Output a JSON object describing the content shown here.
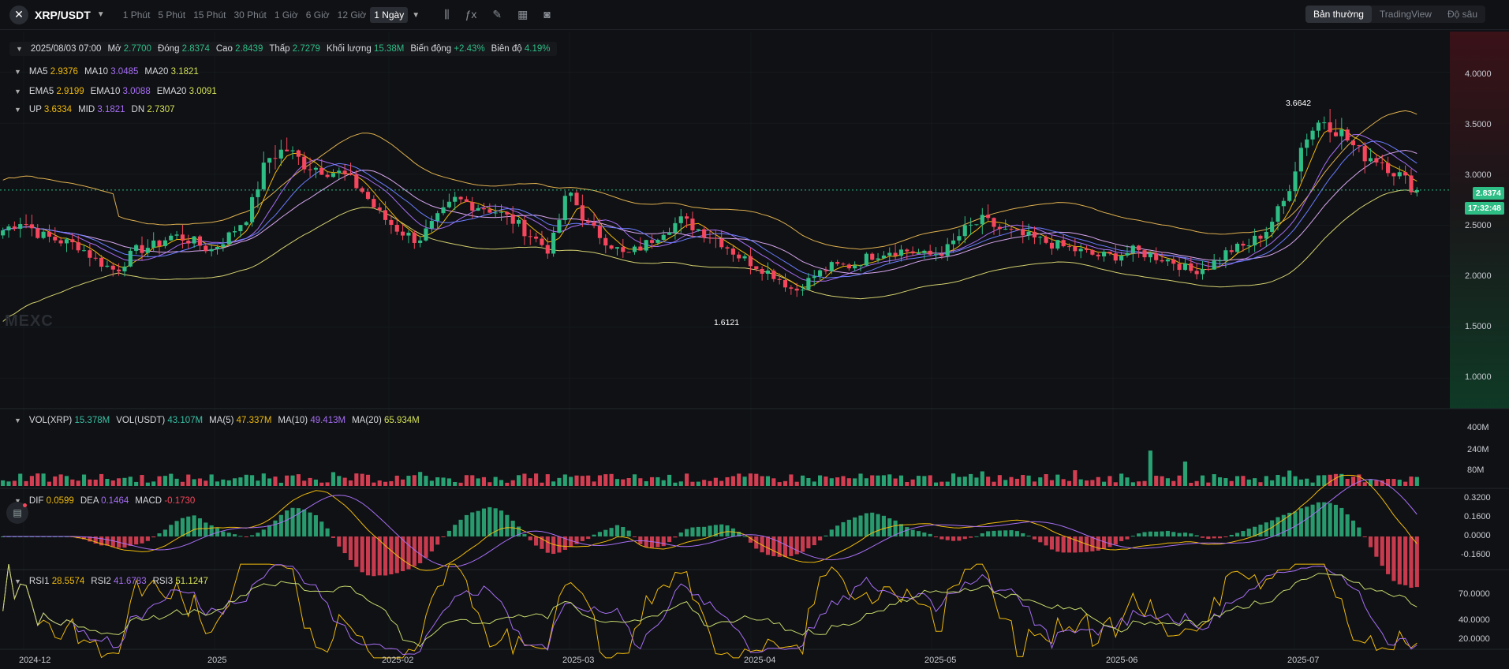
{
  "header": {
    "symbol": "XRP/USDT",
    "intervals": [
      "1 Phút",
      "5 Phút",
      "15 Phút",
      "30 Phút",
      "1 Giờ",
      "6 Giờ",
      "12 Giờ",
      "1 Ngày"
    ],
    "active_interval": "1 Ngày",
    "views": [
      "Bản thường",
      "TradingView",
      "Độ sâu"
    ],
    "active_view": "Bản thường"
  },
  "ohlc": {
    "date": "2025/08/03 07:00",
    "open_label": "Mở",
    "open": "2.7700",
    "close_label": "Đóng",
    "close": "2.8374",
    "high_label": "Cao",
    "high": "2.8439",
    "low_label": "Thấp",
    "low": "2.7279",
    "vol_label": "Khối lượng",
    "vol": "15.38M",
    "change_label": "Biến động",
    "change": "+2.43%",
    "amp_label": "Biên độ",
    "amp": "4.19%"
  },
  "ma": {
    "ma5": "2.9376",
    "ma10": "3.0485",
    "ma20": "3.1821"
  },
  "ema": {
    "ema5": "2.9199",
    "ema10": "3.0088",
    "ema20": "3.0091"
  },
  "boll": {
    "up": "3.6334",
    "mid": "3.1821",
    "dn": "2.7307"
  },
  "vol": {
    "xrp": "15.378M",
    "usdt": "43.107M",
    "ma5": "47.337M",
    "ma10": "49.413M",
    "ma20": "65.934M"
  },
  "macd": {
    "dif": "0.0599",
    "dea": "0.1464",
    "macd": "-0.1730"
  },
  "rsi": {
    "rsi1": "28.5574",
    "rsi2": "41.6783",
    "rsi3": "51.1247"
  },
  "watermark": "MEXC",
  "current_price": "2.8374",
  "countdown": "17:32:48",
  "high_mark": "3.6642",
  "low_mark": "1.6121",
  "colors": {
    "up": "#2ebd85",
    "down": "#f6465d",
    "bg": "#0f1114"
  },
  "chart_data": {
    "type": "candlestick",
    "price_axis": [
      "4.0000",
      "3.5000",
      "3.0000",
      "2.5000",
      "2.0000",
      "1.5000",
      "1.0000"
    ],
    "price_range": [
      0.7,
      4.4
    ],
    "vol_axis": [
      "400M",
      "240M",
      "80M"
    ],
    "macd_axis": [
      "0.3200",
      "0.1600",
      "0.0000",
      "-0.1600"
    ],
    "rsi_axis": [
      "70.0000",
      "40.0000",
      "20.0000"
    ],
    "x_labels": [
      "2024-12",
      "2025",
      "2025-02",
      "2025-03",
      "2025-04",
      "2025-05",
      "2025-06",
      "2025-07"
    ],
    "close_path": [
      2.45,
      2.55,
      2.4,
      2.35,
      2.3,
      2.15,
      2.05,
      2.25,
      2.3,
      2.4,
      2.35,
      2.25,
      2.4,
      2.6,
      3.15,
      3.25,
      3.1,
      3.05,
      3.0,
      2.85,
      2.6,
      2.45,
      2.35,
      2.55,
      2.75,
      2.7,
      2.65,
      2.55,
      2.4,
      2.25,
      2.85,
      2.5,
      2.35,
      2.2,
      2.3,
      2.45,
      2.55,
      2.45,
      2.35,
      2.2,
      2.1,
      2.0,
      1.85,
      2.0,
      2.1,
      2.1,
      2.2,
      2.25,
      2.25,
      2.2,
      2.25,
      2.45,
      2.55,
      2.45,
      2.4,
      2.35,
      2.3,
      2.25,
      2.2,
      2.2,
      2.25,
      2.2,
      2.15,
      2.05,
      2.1,
      2.25,
      2.3,
      2.45,
      2.75,
      3.35,
      3.55,
      3.4,
      3.2,
      3.15,
      3.0,
      2.84
    ],
    "high_point": 3.6642,
    "low_point": 1.6121
  }
}
